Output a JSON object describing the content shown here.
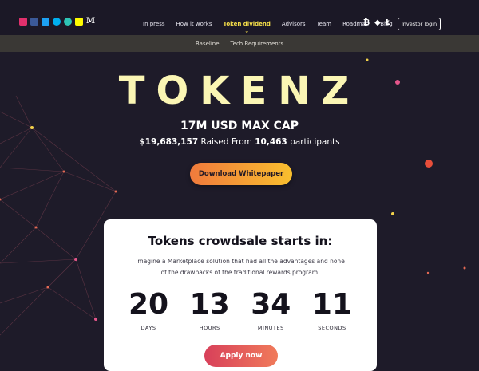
{
  "header": {
    "social_icons": [
      "instagram-icon",
      "facebook-icon",
      "twitter-icon",
      "skype-icon",
      "reddit-icon",
      "snapchat-icon",
      "medium-icon"
    ],
    "medium_glyph": "M",
    "nav": [
      "In press",
      "How it works",
      "Token dividend",
      "Advisors",
      "Team",
      "Roadmap",
      "Blog"
    ],
    "active_nav": "Token dividend",
    "crypto_icons": [
      "bitcoin-icon",
      "ethereum-icon",
      "litecoin-icon"
    ],
    "crypto_glyphs": [
      "₿",
      "◆",
      "Ł"
    ],
    "login_label": "Investor login"
  },
  "subnav": [
    "Baseline",
    "Tech Requirements"
  ],
  "hero": {
    "title": "TOKENZ",
    "cap": "17M USD MAX CAP",
    "raised_amount": "$19,683,157",
    "raised_text": "Raised From",
    "participants_count": "10,463",
    "participants_text": "participants",
    "cta_label": "Download Whitepaper"
  },
  "crowdsale": {
    "title": "Tokens crowdsale starts in:",
    "description": "Imagine a Marketplace solution that had all the advantages and none of the drawbacks of the traditional rewards program.",
    "countdown": [
      {
        "value": "20",
        "label": "DAYS"
      },
      {
        "value": "13",
        "label": "HOURS"
      },
      {
        "value": "34",
        "label": "MINUTES"
      },
      {
        "value": "11",
        "label": "SECONDS"
      }
    ],
    "apply_label": "Apply now"
  },
  "colors": {
    "background": "#1e1b29",
    "accent_yellow": "#f6df4a",
    "title_color": "#fbf6b4",
    "cta_gradient": [
      "#f07a3c",
      "#f9bf2e"
    ],
    "apply_gradient": [
      "#d8405a",
      "#f07a5a"
    ]
  }
}
